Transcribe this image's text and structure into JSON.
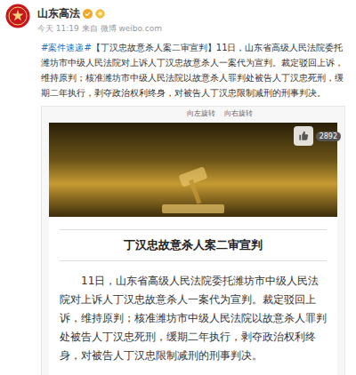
{
  "account": {
    "name": "山东高法",
    "verified": true,
    "time": "今天 11:19 来自 微博 weibo.com"
  },
  "post": {
    "hashtag": "#案件速递#",
    "text": "【丁汉忠故意杀人案二审宣判】11日，山东省高级人民法院委托潍坊市中级人民法院对上诉人丁汉忠故意杀人一案代为宣判。裁定驳回上诉，维持原判；核准潍坊市中级人民法院以故意杀人罪判处被告人丁汉忠死刑，缓期二年执行，剥夺政治权利终身，对被告人丁汉忠限制减刑的刑事判决。"
  },
  "card": {
    "tools": [
      "向左旋转",
      "向右旋转"
    ],
    "likes": "2892",
    "title": "丁汉忠故意杀人案二审宣判",
    "body": "11日，山东省高级人民法院委托潍坊市中级人民法院对上诉人丁汉忠故意杀人一案代为宣判。裁定驳回上诉，维持原判；核准潍坊市中级人民法院以故意杀人罪判处被告人丁汉忠死刑，缓期二年执行，剥夺政治权利终身，对被告人丁汉忠限制减刑的刑事判决。"
  }
}
